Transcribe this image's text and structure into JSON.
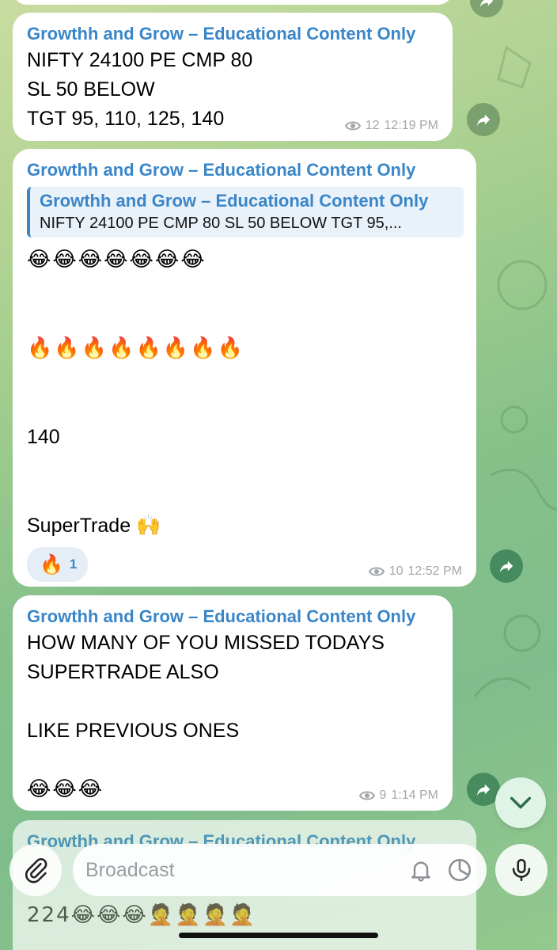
{
  "channel_name": "Growthh and Grow – Educational Content Only",
  "messages": [
    {
      "sender": "Growthh and Grow – Educational Content Only",
      "lines": [
        "NIFTY 24100 PE CMP 80",
        "SL 50 BELOW",
        "TGT 95, 110, 125, 140"
      ],
      "views": "12",
      "time": "12:19 PM"
    },
    {
      "sender": "Growthh and Grow – Educational Content Only",
      "reply_sender": "Growthh and Grow – Educational Content Only",
      "reply_text": "NIFTY 24100 PE CMP 80 SL 50 BELOW TGT 95,...",
      "emoji_row_1": "😂😂😂😂😂😂😂",
      "emoji_row_2": "🔥🔥🔥🔥🔥🔥🔥🔥",
      "number_line": "140",
      "supertrade_line": "SuperTrade 🙌",
      "reaction_emoji": "🔥",
      "reaction_count": "1",
      "views": "10",
      "time": "12:52 PM"
    },
    {
      "sender": "Growthh and Grow – Educational Content Only",
      "lines": [
        "HOW MANY OF YOU MISSED TODAYS",
        "SUPERTRADE ALSO"
      ],
      "line_3": "LIKE PREVIOUS ONES",
      "emoji_row": "😂😂😂",
      "views": "9",
      "time": "1:14 PM"
    },
    {
      "sender": "Growthh and Grow – Educational Content Only",
      "partial_text": "224😂😂😂🤦🤦🤦🤦"
    }
  ],
  "input": {
    "placeholder": "Broadcast"
  },
  "icons": {
    "attach": "paperclip-icon",
    "mute": "bell-icon",
    "timer": "timer-icon",
    "mic": "microphone-icon",
    "forward": "forward-arrow-icon",
    "scroll": "chevron-down-icon",
    "views": "eye-icon"
  },
  "colors": {
    "accent": "#3a86c8",
    "bubble": "#ffffff",
    "meta": "#a4a7aa"
  }
}
